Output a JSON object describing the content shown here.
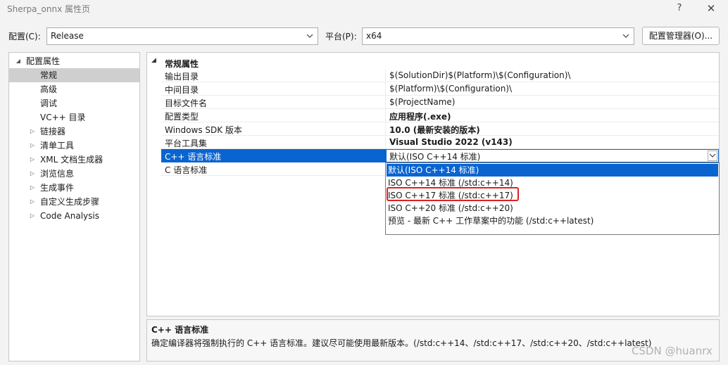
{
  "window": {
    "title": "Sherpa_onnx 属性页",
    "help_label": "?",
    "close_label": "✕"
  },
  "config_bar": {
    "configuration_label": "配置(C):",
    "configuration_value": "Release",
    "platform_label": "平台(P):",
    "platform_value": "x64",
    "manager_button_label": "配置管理器(O)..."
  },
  "tree": {
    "root": "配置属性",
    "items": [
      {
        "label": "常规",
        "selected": true,
        "expandable": false
      },
      {
        "label": "高级",
        "expandable": false
      },
      {
        "label": "调试",
        "expandable": false
      },
      {
        "label": "VC++ 目录",
        "expandable": false
      },
      {
        "label": "链接器",
        "expandable": true
      },
      {
        "label": "清单工具",
        "expandable": true
      },
      {
        "label": "XML 文档生成器",
        "expandable": true
      },
      {
        "label": "浏览信息",
        "expandable": true
      },
      {
        "label": "生成事件",
        "expandable": true
      },
      {
        "label": "自定义生成步骤",
        "expandable": true
      },
      {
        "label": "Code Analysis",
        "expandable": true
      }
    ]
  },
  "grid": {
    "section_title": "常规属性",
    "rows": [
      {
        "name": "输出目录",
        "value": "$(SolutionDir)$(Platform)\\$(Configuration)\\",
        "bold": false
      },
      {
        "name": "中间目录",
        "value": "$(Platform)\\$(Configuration)\\",
        "bold": false
      },
      {
        "name": "目标文件名",
        "value": "$(ProjectName)",
        "bold": false
      },
      {
        "name": "配置类型",
        "value": "应用程序(.exe)",
        "bold": true
      },
      {
        "name": "Windows SDK 版本",
        "value": "10.0 (最新安装的版本)",
        "bold": true
      },
      {
        "name": "平台工具集",
        "value": "Visual Studio 2022 (v143)",
        "bold": true
      },
      {
        "name": "C++ 语言标准",
        "value": "默认(ISO C++14 标准)",
        "bold": false,
        "active": true
      },
      {
        "name": "C 语言标准",
        "value": "",
        "bold": false
      }
    ]
  },
  "dropdown": {
    "options": [
      "默认(ISO C++14 标准)",
      "ISO C++14 标准 (/std:c++14)",
      "ISO C++17 标准 (/std:c++17)",
      "ISO C++20 标准 (/std:c++20)",
      "预览 - 最新 C++ 工作草案中的功能 (/std:c++latest)"
    ],
    "selected_index": 0,
    "highlighted_index": 2
  },
  "description": {
    "title": "C++ 语言标准",
    "text": "确定编译器将强制执行的 C++ 语言标准。建议尽可能使用最新版本。(/std:c++14、/std:c++17、/std:c++20、/std:c++latest)"
  },
  "watermark": "CSDN @huanrx",
  "colors": {
    "selection_blue": "#0a64d0",
    "highlight_red": "#e02020",
    "tree_selected": "#cfcfcf"
  }
}
